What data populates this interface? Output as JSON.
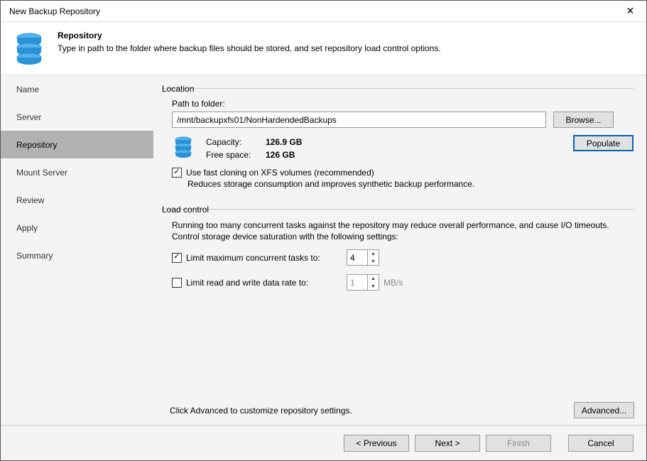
{
  "window": {
    "title": "New Backup Repository"
  },
  "header": {
    "title": "Repository",
    "subtitle": "Type in path to the folder where backup files should be stored, and set repository load control options."
  },
  "sidebar": {
    "items": [
      {
        "label": "Name",
        "selected": false
      },
      {
        "label": "Server",
        "selected": false
      },
      {
        "label": "Repository",
        "selected": true
      },
      {
        "label": "Mount Server",
        "selected": false
      },
      {
        "label": "Review",
        "selected": false
      },
      {
        "label": "Apply",
        "selected": false
      },
      {
        "label": "Summary",
        "selected": false
      }
    ]
  },
  "location": {
    "legend": "Location",
    "path_label": "Path to folder:",
    "path_value": "/mnt/backupxfs01/NonHardendedBackups",
    "browse_label": "Browse...",
    "populate_label": "Populate",
    "capacity_label": "Capacity:",
    "capacity_value": "126.9 GB",
    "free_label": "Free space:",
    "free_value": "126 GB",
    "fast_clone_checked": true,
    "fast_clone_label": "Use fast cloning on XFS volumes (recommended)",
    "fast_clone_hint": "Reduces storage consumption and improves synthetic backup performance."
  },
  "load": {
    "legend": "Load control",
    "description": "Running too many concurrent tasks against the repository may reduce overall performance, and cause I/O timeouts. Control storage device saturation with the following settings:",
    "limit_tasks_checked": true,
    "limit_tasks_label": "Limit maximum concurrent tasks to:",
    "limit_tasks_value": "4",
    "limit_rate_checked": false,
    "limit_rate_label": "Limit read and write data rate to:",
    "limit_rate_value": "1",
    "limit_rate_unit": "MB/s"
  },
  "advanced": {
    "hint": "Click Advanced to customize repository settings.",
    "btn": "Advanced..."
  },
  "footer": {
    "prev": "<  Previous",
    "next": "Next  >",
    "finish": "Finish",
    "cancel": "Cancel"
  },
  "colors": {
    "accent": "#0a62b3",
    "disk": "#2a93d6"
  }
}
